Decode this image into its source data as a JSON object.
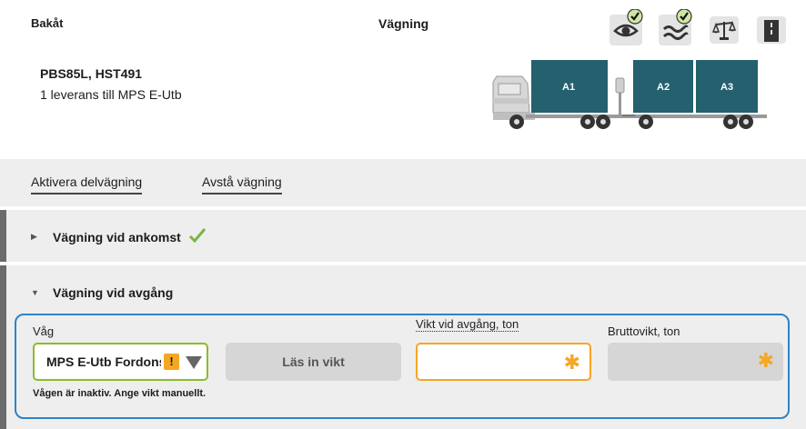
{
  "header": {
    "back_label": "Bakåt",
    "title": "Vägning",
    "icons": [
      "eye-check-icon",
      "wave-check-icon",
      "scale-icon",
      "road-icon"
    ],
    "vehicle_id": "PBS85L, HST491",
    "delivery": "1 leverans till MPS E-Utb"
  },
  "truck": {
    "compartments": [
      "A1",
      "A2",
      "A3"
    ],
    "container_color": "#24606e"
  },
  "actions": {
    "partial_weighing": "Aktivera delvägning",
    "skip_weighing": "Avstå vägning"
  },
  "sections": {
    "arrival": {
      "title": "Vägning vid ankomst",
      "status": "done",
      "expanded": false
    },
    "departure": {
      "title": "Vägning vid avgång",
      "expanded": true
    }
  },
  "departure_form": {
    "scale_label": "Våg",
    "scale_value": "MPS E-Utb Fordonsvåg",
    "warning_mark": "!",
    "read_weight_button": "Läs in vikt",
    "weight_label": "Vikt vid avgång, ton",
    "weight_value": "",
    "gross_label": "Bruttovikt, ton",
    "gross_value": "",
    "hint": "Vågen är inaktiv. Ange vikt manuellt."
  },
  "colors": {
    "accent_blue": "#2f83c4",
    "ok_green": "#8bbc2a",
    "warning_orange": "#f5a623"
  }
}
